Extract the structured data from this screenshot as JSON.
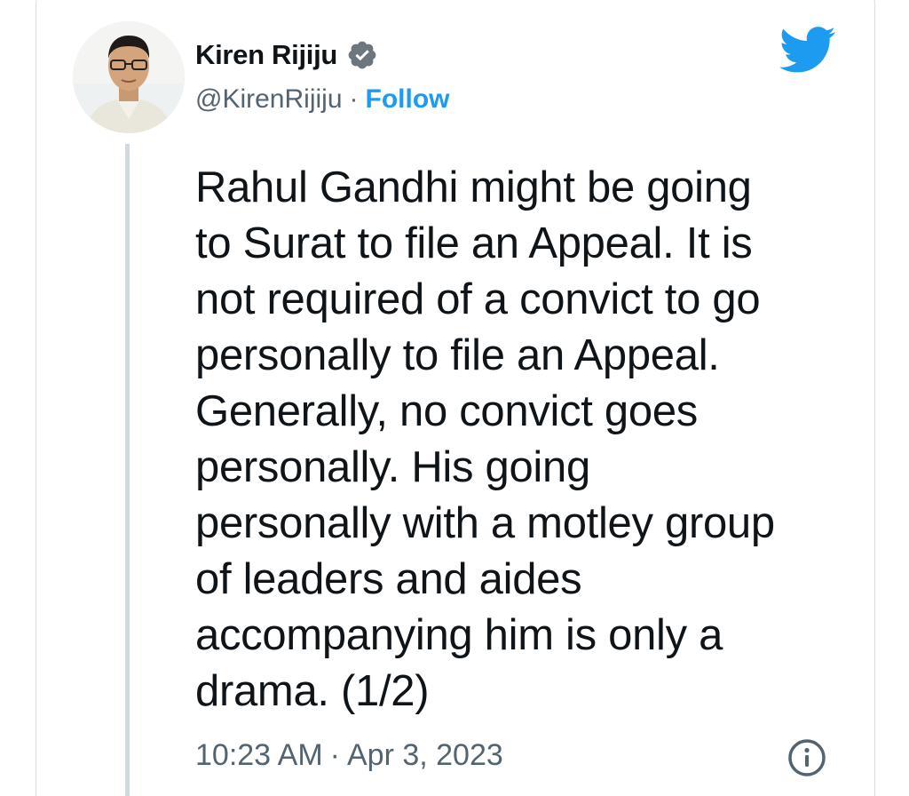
{
  "author": {
    "display_name": "Kiren Rijiju",
    "handle": "@KirenRijiju",
    "separator": "·",
    "follow_label": "Follow",
    "verified_icon": "verified-badge-icon",
    "avatar": "profile-photo"
  },
  "tweet": {
    "text": "Rahul Gandhi might be going\nto Surat to file an Appeal. It is\nnot required of a convict to go\npersonally to file an Appeal.\nGenerally, no convict goes\npersonally. His going\npersonally with a motley group\nof leaders and aides\naccompanying him is only a\ndrama. (1/2)",
    "time": "10:23 AM",
    "separator": "·",
    "date": "Apr 3, 2023"
  },
  "icons": {
    "brand": "twitter-bird-icon",
    "info": "info-icon"
  },
  "colors": {
    "accent": "#1d9bf0",
    "text": "#0f1419",
    "muted": "#536471",
    "border": "#cfd9de"
  }
}
